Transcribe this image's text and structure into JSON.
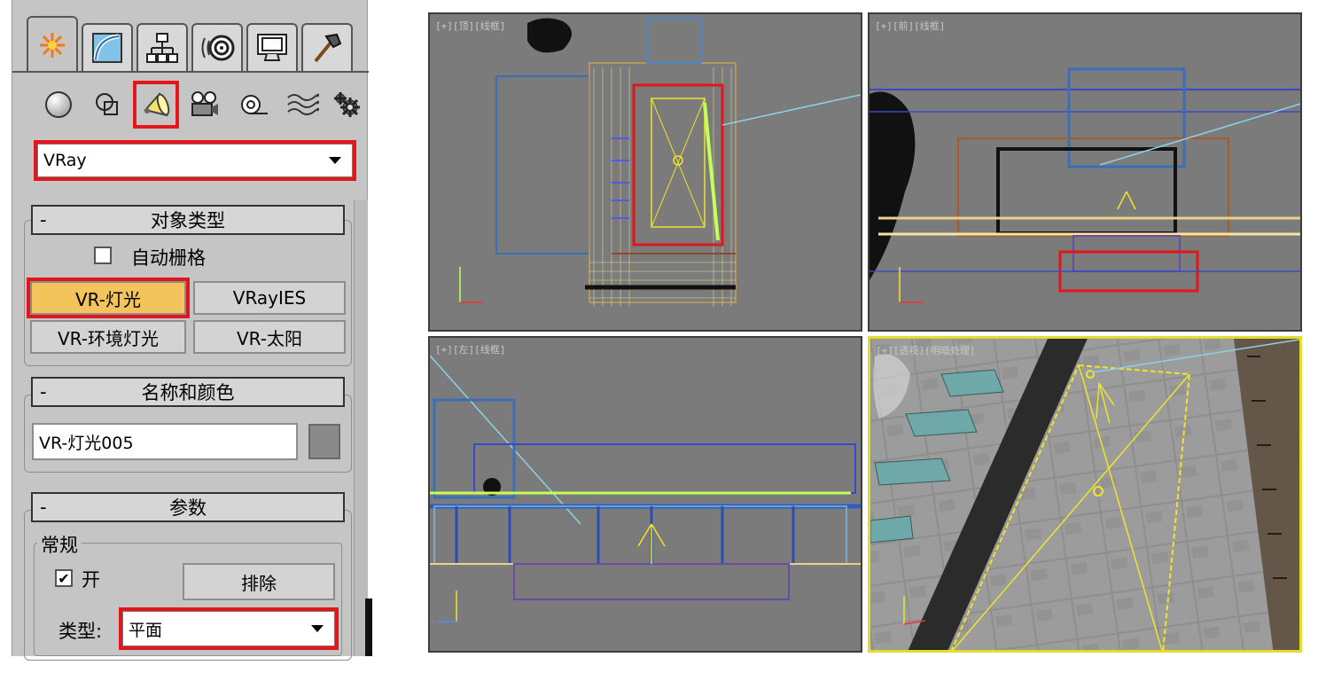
{
  "command_panel": {
    "tabs": [
      {
        "name": "create-tab",
        "icon": "sun-star-icon",
        "active": true
      },
      {
        "name": "modify-tab",
        "icon": "modify-curve-icon",
        "active": false
      },
      {
        "name": "hierarchy-tab",
        "icon": "hierarchy-icon",
        "active": false
      },
      {
        "name": "motion-tab",
        "icon": "motion-wheel-icon",
        "active": false
      },
      {
        "name": "display-tab",
        "icon": "display-monitor-icon",
        "active": false
      },
      {
        "name": "utilities-tab",
        "icon": "hammer-icon",
        "active": false
      }
    ],
    "categories": [
      {
        "name": "geometry",
        "icon": "sphere-icon"
      },
      {
        "name": "shapes",
        "icon": "shapes-icon"
      },
      {
        "name": "lights",
        "icon": "spotlight-icon",
        "selected": true
      },
      {
        "name": "cameras",
        "icon": "camera-icon"
      },
      {
        "name": "helpers",
        "icon": "tape-helper-icon"
      },
      {
        "name": "space-warps",
        "icon": "wave-icon"
      },
      {
        "name": "systems",
        "icon": "gear-cluster-icon"
      }
    ],
    "renderer_dropdown": "VRay",
    "object_type": {
      "title": "对象类型",
      "collapse": "-",
      "autogrid_label": "自动栅格",
      "autogrid_checked": false,
      "buttons": [
        "VR-灯光",
        "VRayIES",
        "VR-环境灯光",
        "VR-太阳"
      ],
      "active_button": "VR-灯光"
    },
    "name_color": {
      "title": "名称和颜色",
      "collapse": "-",
      "name_value": "VR-灯光005",
      "swatch_color": "#8a8a8a"
    },
    "parameters": {
      "title": "参数",
      "collapse": "-",
      "group_label": "常规",
      "on_label": "开",
      "on_checked": true,
      "check_mark": "✔",
      "exclude_button": "排除",
      "type_label": "类型:",
      "type_value": "平面"
    }
  },
  "viewports": {
    "top": {
      "label": "[+][顶][线框]"
    },
    "front": {
      "label": "[+][前][线框]"
    },
    "left": {
      "label": "[+][左][线框]"
    },
    "perspective": {
      "label": "[+][透视][明暗处理]",
      "active": true
    }
  },
  "colors": {
    "highlight_red": "#e3161c",
    "active_button": "#f2c45b",
    "viewport_bg": "#7b7b7b",
    "light_yellow": "#f0e52b",
    "active_viewport_border": "#e2dc2d"
  }
}
